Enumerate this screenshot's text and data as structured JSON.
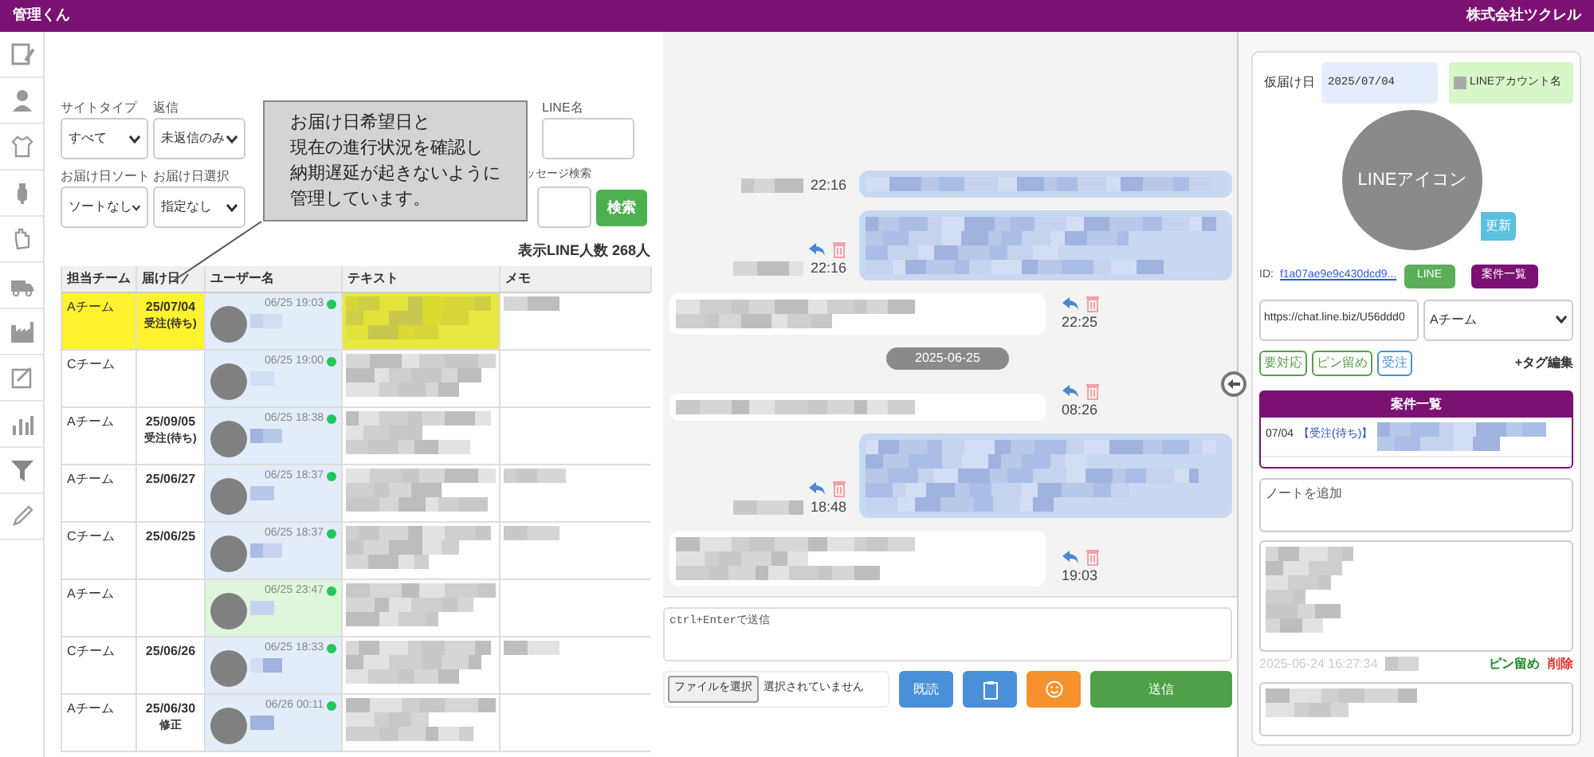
{
  "header": {
    "app_name": "管理くん",
    "company": "株式会社ツクレル"
  },
  "filters": {
    "row_1": [
      {
        "kind": "select",
        "label": "サイトタイプ",
        "value": "すべて"
      },
      {
        "kind": "select",
        "label": "返信",
        "value": "未返信のみ"
      },
      {
        "kind": "covered"
      },
      {
        "kind": "covered"
      },
      {
        "kind": "covered"
      },
      {
        "kind": "input",
        "label": "LINE名"
      }
    ],
    "row_2": [
      {
        "kind": "select",
        "label": "お届け日ソート",
        "value": "ソートなし"
      },
      {
        "kind": "select",
        "label": "お届け日選択",
        "value": "指定なし"
      },
      {
        "kind": "covered"
      },
      {
        "kind": "covered"
      },
      {
        "kind": "input",
        "label": "ッセージ検索"
      }
    ],
    "search_button": "検索"
  },
  "tooltip": {
    "lines": [
      "お届け日希望日と",
      "現在の進行状況を確認し",
      "納期遅延が起きないように",
      "管理しています。"
    ]
  },
  "line_count": "表示LINE人数 268人",
  "table": {
    "columns": [
      "担当チーム",
      "届け日",
      "ユーザー名",
      "テキスト",
      "メモ"
    ],
    "rows": [
      {
        "team": "Aチーム",
        "date": "25/07/04",
        "status": "受注(待ち)",
        "time": "06/25 19:03",
        "highlighted": true,
        "color": "#e3edf9",
        "memo": true
      },
      {
        "team": "Cチーム",
        "time": "06/25 19:00",
        "highlighted": false,
        "color": "#e3edf9",
        "memo": false
      },
      {
        "team": "Aチーム",
        "date": "25/09/05",
        "status": "受注(待ち)",
        "time": "06/25 18:38",
        "highlighted": false,
        "color": "#e3edf9",
        "memo": false
      },
      {
        "team": "Aチーム",
        "date": "25/06/27",
        "time": "06/25 18:37",
        "highlighted": false,
        "color": "#e3edf9",
        "memo": true
      },
      {
        "team": "Cチーム",
        "date": "25/06/25",
        "time": "06/25 18:37",
        "highlighted": false,
        "color": "#e3edf9",
        "memo": true
      },
      {
        "team": "Aチーム",
        "time": "06/25 23:47",
        "highlighted": false,
        "color": "#dff5dc",
        "memo": false
      },
      {
        "team": "Cチーム",
        "date": "25/06/26",
        "time": "06/25 18:33",
        "highlighted": false,
        "color": "#e3edf9",
        "memo": true
      },
      {
        "team": "Aチーム",
        "date": "25/06/30",
        "status": "修正",
        "time": "06/26 00:11",
        "highlighted": false,
        "color": "#e3edf9",
        "memo": false
      }
    ]
  },
  "chat": {
    "messages": [
      {
        "kind": "sent",
        "time": "22:16",
        "actions": false
      },
      {
        "kind": "sent",
        "time": "22:16",
        "actions": true
      },
      {
        "kind": "received",
        "time": "22:25",
        "actions": true
      },
      {
        "kind": "date",
        "text": "2025-06-25"
      },
      {
        "kind": "received",
        "time": "08:26",
        "actions": true
      },
      {
        "kind": "sent",
        "time": "18:48",
        "actions": true
      },
      {
        "kind": "received",
        "time": "19:03",
        "actions": true
      }
    ],
    "input_placeholder": "ctrl+Enterで送信",
    "file_button": "ファイルを選択",
    "file_status": "選択されていません",
    "read_button": "既読",
    "send_button": "送信"
  },
  "profile": {
    "tentative_date_label": "仮届け日",
    "tentative_date": "2025/07/04",
    "account_name": "LINEアカウント名",
    "avatar_text": "LINEアイコン",
    "update_button": "更新",
    "id_label": "ID:",
    "id_link": "f1a07ae9e9c430dcd9...",
    "line_button": "LINE",
    "cases_button": "案件一覧",
    "url": "https://chat.line.biz/U56ddd0",
    "team": "Aチーム",
    "tags": [
      {
        "label": "要対応",
        "color": "#5a9e4b"
      },
      {
        "label": "ピン留め",
        "color": "#5a9e4b"
      },
      {
        "label": "受注",
        "color": "#4a90d9"
      }
    ],
    "tag_edit": "+タグ編集",
    "case_list": {
      "title": "案件一覧",
      "items": [
        {
          "date": "07/04",
          "status": "【受注(待ち)】"
        }
      ]
    },
    "note_placeholder": "ノートを追加",
    "notes": [
      {
        "timestamp": "2025-06-24 16:27:34",
        "pin": "ピン留め",
        "delete": "削除"
      }
    ]
  }
}
